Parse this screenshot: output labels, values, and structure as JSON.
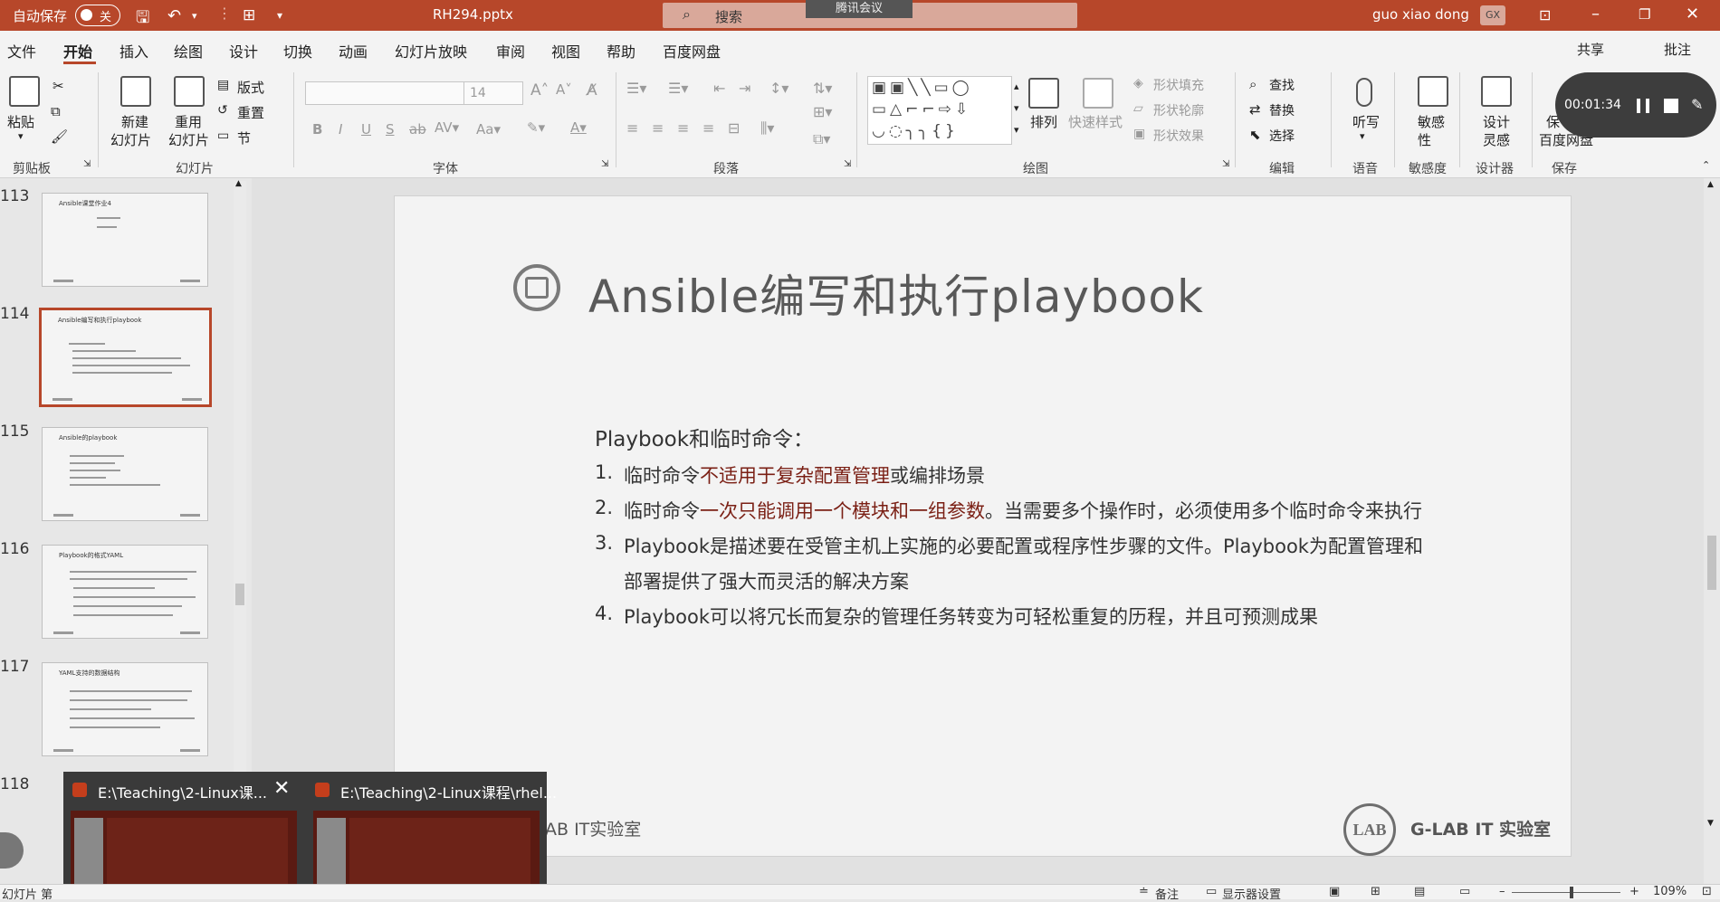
{
  "titlebar": {
    "autosave_label": "自动保存",
    "autosave_state": "关",
    "filename": "RH294.pptx",
    "search_placeholder": "搜索",
    "meeting_badge": "腾讯会议",
    "user_name": "guo xiao dong",
    "user_initials": "GX",
    "bg_color": "#b7472a"
  },
  "menubar": {
    "items": [
      "文件",
      "开始",
      "插入",
      "绘图",
      "设计",
      "切换",
      "动画",
      "幻灯片放映",
      "审阅",
      "视图",
      "帮助",
      "百度网盘"
    ],
    "active": "开始",
    "share": "共享",
    "comments": "批注"
  },
  "ribbon": {
    "clipboard": {
      "paste": "粘贴",
      "group": "剪贴板"
    },
    "slides": {
      "new_slide_1": "新建",
      "new_slide_2": "幻灯片",
      "reuse_1": "重用",
      "reuse_2": "幻灯片",
      "layout": "版式",
      "reset": "重置",
      "section": "节",
      "group": "幻灯片"
    },
    "font": {
      "size": "14",
      "group": "字体"
    },
    "paragraph": {
      "group": "段落"
    },
    "drawing": {
      "arrange": "排列",
      "quick_styles": "快速样式",
      "fill": "形状填充",
      "outline": "形状轮廓",
      "effects": "形状效果",
      "group": "绘图"
    },
    "editing": {
      "find": "查找",
      "replace": "替换",
      "select": "选择",
      "group": "编辑"
    },
    "voice": {
      "dictate": "听写",
      "group": "语音"
    },
    "sensitivity": {
      "label_1": "敏感",
      "label_2": "性",
      "group": "敏感度"
    },
    "designer": {
      "label_1": "设计",
      "label_2": "灵感",
      "group": "设计器"
    },
    "save": {
      "label_1": "保",
      "label_2": "百度网盘",
      "group": "保存"
    }
  },
  "recording": {
    "time": "00:01:34"
  },
  "thumbnails": [
    {
      "num": "113",
      "title": "Ansible课堂作业4"
    },
    {
      "num": "114",
      "title": "Ansible编写和执行playbook",
      "selected": true
    },
    {
      "num": "115",
      "title": "Ansible的playbook"
    },
    {
      "num": "116",
      "title": "Playbook的格式YAML"
    },
    {
      "num": "117",
      "title": "YAML支持的数据结构"
    },
    {
      "num": "118",
      "title": ""
    }
  ],
  "slide": {
    "title": "Ansible编写和执行playbook",
    "heading": "Playbook和临时命令：",
    "items": [
      {
        "num": "1.",
        "parts": [
          {
            "t": "临时命令",
            "em": false
          },
          {
            "t": "不适用于复杂配置管理",
            "em": true
          },
          {
            "t": "或编排场景",
            "em": false
          }
        ]
      },
      {
        "num": "2.",
        "parts": [
          {
            "t": "临时命令",
            "em": false
          },
          {
            "t": "一次只能调用一个模块和一组参数",
            "em": true
          },
          {
            "t": "。当需要多个操作时，必须使用多个临时命令来执行",
            "em": false
          }
        ]
      },
      {
        "num": "3.",
        "parts": [
          {
            "t": "Playbook是描述要在受管主机上实施的必要配置或程序性步骤的文件。Playbook为配置管理和",
            "em": false
          }
        ]
      },
      {
        "num": "",
        "parts": [
          {
            "t": "部署提供了强大而灵活的解决方案",
            "em": false
          }
        ]
      },
      {
        "num": "4.",
        "parts": [
          {
            "t": "Playbook可以将冗长而复杂的管理任务转变为可轻松重复的历程，并且可预测成果",
            "em": false
          }
        ]
      }
    ],
    "logo": "LAB",
    "logo_text": "G-LAB IT 实验室",
    "left_footer": "AB IT实验室"
  },
  "taskbar_preview": {
    "win1": "E:\\Teaching\\2-Linux课...",
    "win2": "E:\\Teaching\\2-Linux课程\\rhel..."
  },
  "statusbar": {
    "slide_label": "幻灯片 第",
    "notes": "备注",
    "display": "显示器设置",
    "zoom": "109%"
  }
}
